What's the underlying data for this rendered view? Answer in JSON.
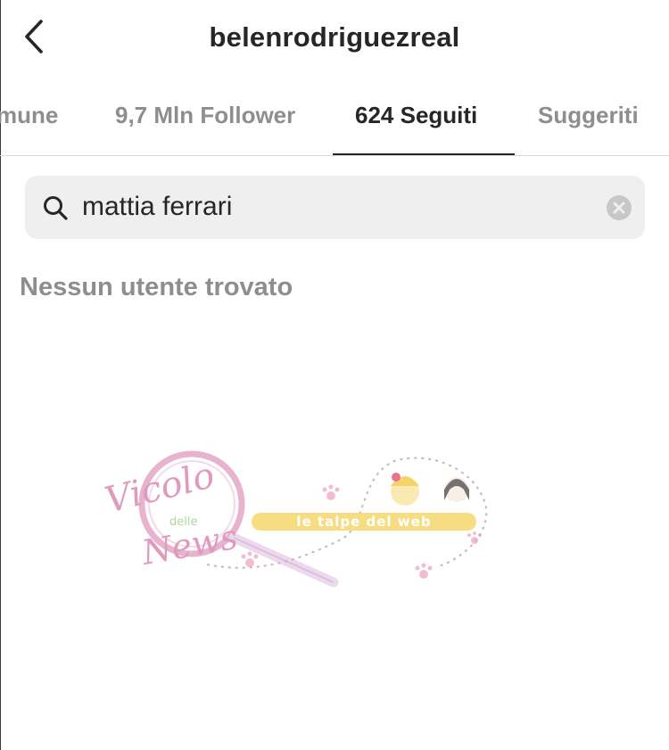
{
  "header": {
    "title": "belenrodriguezreal",
    "back_icon": "chevron-left-icon"
  },
  "tabs": [
    {
      "label": "mune",
      "active": false
    },
    {
      "label": "9,7 Mln Follower",
      "active": false
    },
    {
      "label": "624 Seguiti",
      "active": true
    },
    {
      "label": "Suggeriti",
      "active": false
    }
  ],
  "search": {
    "value": "mattia ferrari",
    "icon": "search-icon",
    "clear_icon": "clear-icon"
  },
  "results": {
    "empty_message": "Nessun utente trovato"
  },
  "watermark": {
    "logo_text": [
      "Vicolo",
      "delle",
      "News"
    ],
    "banner_text": "le talpe del web"
  },
  "colors": {
    "text_primary": "#262626",
    "text_secondary": "#8e8e8e",
    "search_bg": "#efefef",
    "divider": "#dbdbdb"
  }
}
